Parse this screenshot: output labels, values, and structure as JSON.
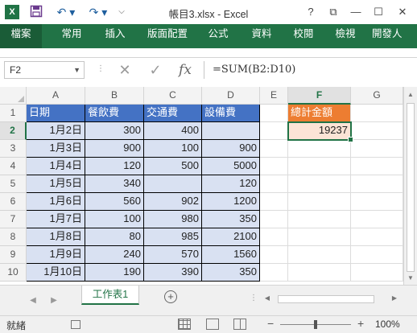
{
  "window": {
    "title": "帳目3.xlsx - Excel",
    "app_icon_label": "X",
    "quick_access": [
      "save-icon",
      "undo-icon",
      "redo-icon",
      "customize-icon"
    ],
    "buttons": {
      "help": "?",
      "restore": "⧉",
      "minimize": "—",
      "maximize": "☐",
      "close": "✕"
    }
  },
  "ribbon": {
    "tabs": [
      "檔案",
      "常用",
      "插入",
      "版面配置",
      "公式",
      "資料",
      "校閱",
      "檢視",
      "開發人"
    ]
  },
  "formula_bar": {
    "name_box": "F2",
    "cancel": "✕",
    "enter": "✓",
    "fx": "fx",
    "formula": "=SUM(B2:D10)"
  },
  "grid": {
    "columns": [
      "A",
      "B",
      "C",
      "D",
      "E",
      "F",
      "G"
    ],
    "rows": [
      "1",
      "2",
      "3",
      "4",
      "5",
      "6",
      "7",
      "8",
      "9",
      "10"
    ],
    "selected_column": "F",
    "selected_row": "2",
    "headers": [
      "日期",
      "餐飲費",
      "交通費",
      "設備費"
    ],
    "data": [
      [
        "1月2日",
        "300",
        "400",
        ""
      ],
      [
        "1月3日",
        "900",
        "100",
        "900"
      ],
      [
        "1月4日",
        "120",
        "500",
        "5000"
      ],
      [
        "1月5日",
        "340",
        "",
        "120"
      ],
      [
        "1月6日",
        "560",
        "902",
        "1200"
      ],
      [
        "1月7日",
        "100",
        "980",
        "350"
      ],
      [
        "1月8日",
        "80",
        "985",
        "2100"
      ],
      [
        "1月9日",
        "240",
        "570",
        "1560"
      ],
      [
        "1月10日",
        "190",
        "390",
        "350"
      ]
    ],
    "total_label": "總計金額",
    "total_value": "19237",
    "colors": {
      "header_fill": "#4472c4",
      "data_fill": "#d9e1f2",
      "total_label_fill": "#ed7d31",
      "total_value_fill": "#fce4d6",
      "accent": "#217346"
    }
  },
  "sheets": {
    "tabs": [
      "工作表1"
    ],
    "add": "+"
  },
  "status": {
    "ready": "就緒",
    "zoom_minus": "−",
    "zoom_plus": "+",
    "zoom": "100%"
  }
}
